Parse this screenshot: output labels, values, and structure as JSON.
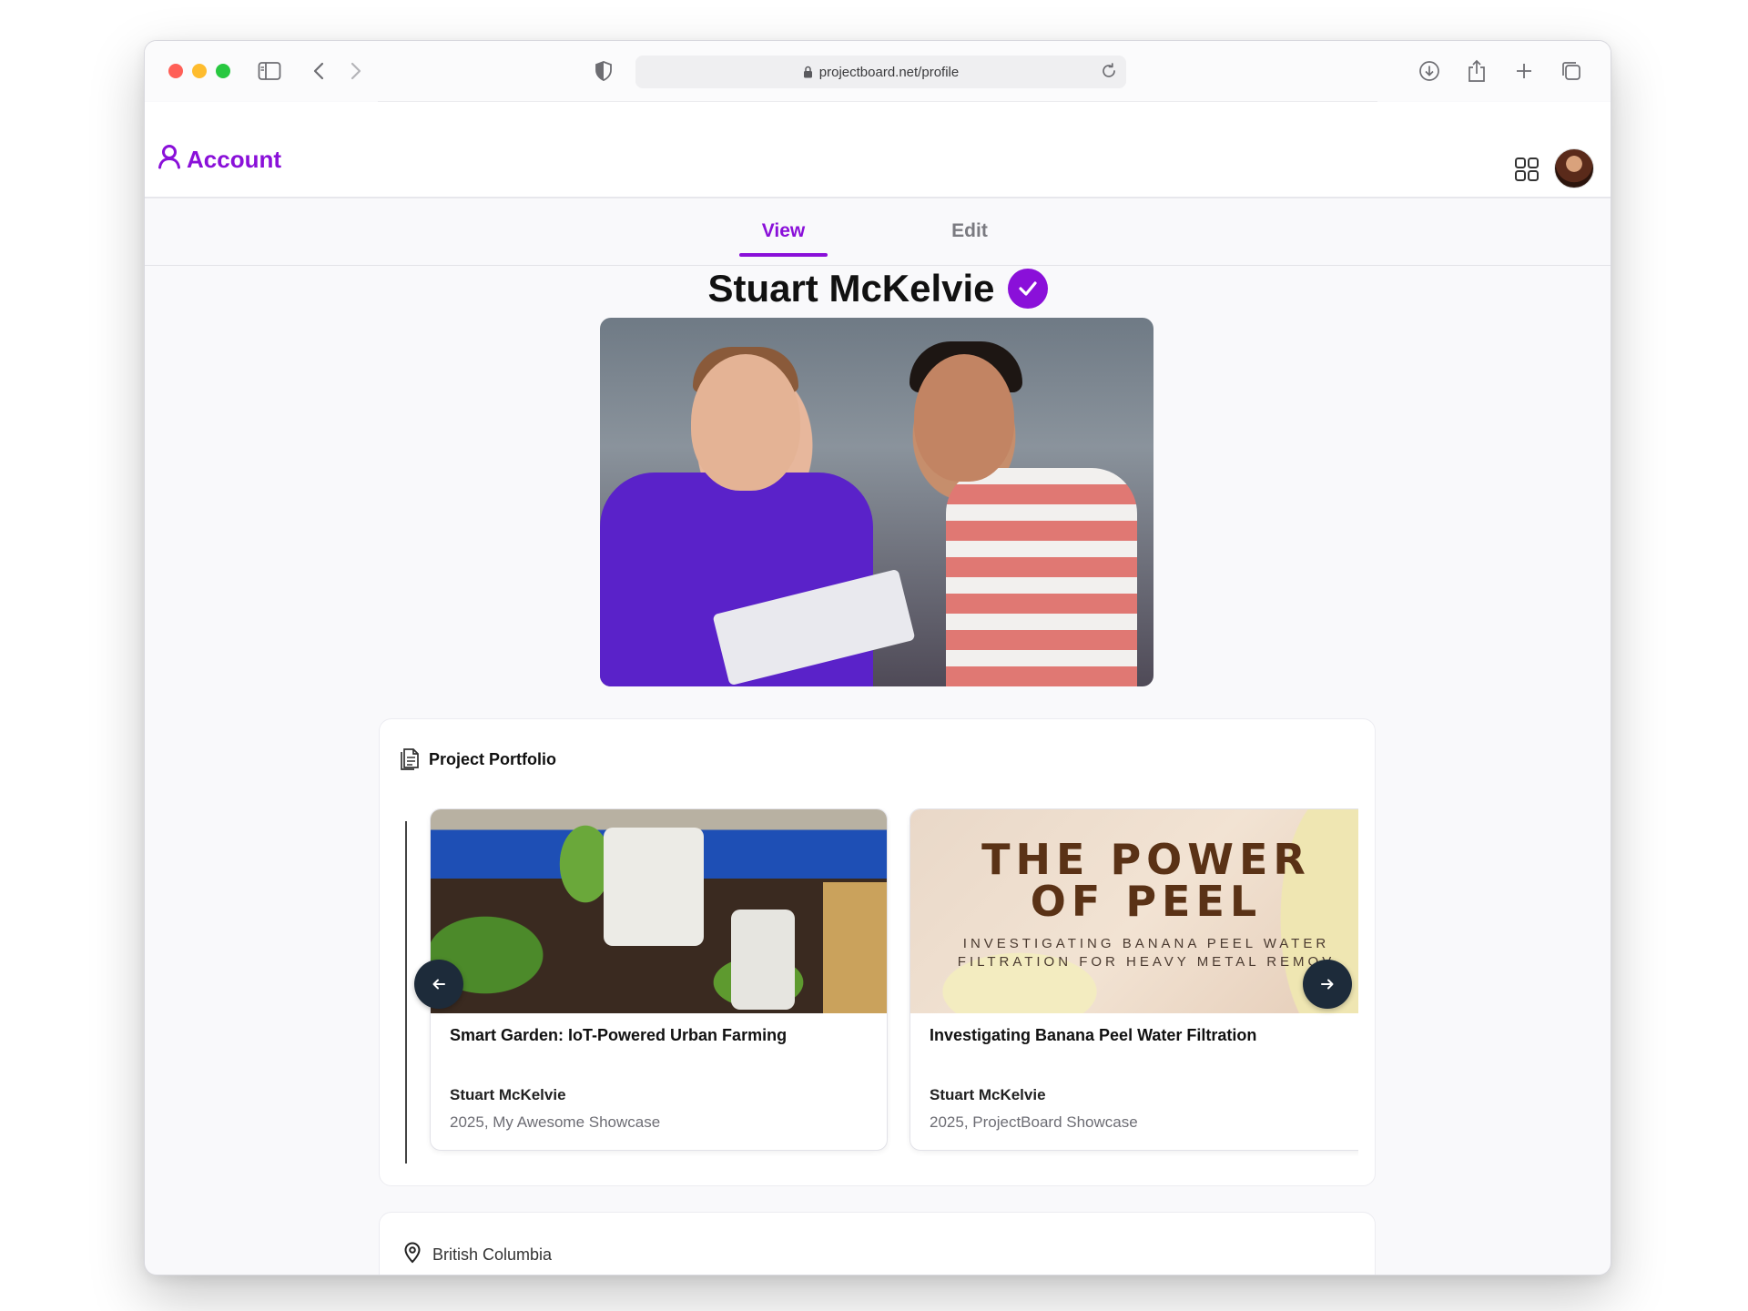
{
  "browser": {
    "url": "projectboard.net/profile"
  },
  "app": {
    "brand_label": "Account"
  },
  "tabs": [
    {
      "label": "View",
      "active": true
    },
    {
      "label": "Edit",
      "active": false
    }
  ],
  "profile": {
    "name": "Stuart McKelvie",
    "verified": true
  },
  "portfolio": {
    "title": "Project Portfolio",
    "projects": [
      {
        "title": "Smart Garden: IoT-Powered Urban Farming",
        "author": "Stuart McKelvie",
        "meta": "2025, My Awesome Showcase"
      },
      {
        "title": "Investigating Banana Peel Water Filtration",
        "author": "Stuart McKelvie",
        "meta": "2025, ProjectBoard Showcase",
        "cover_title_line1": "THE POWER",
        "cover_title_line2": "OF PEEL",
        "cover_sub_line1": "INVESTIGATING BANANA PEEL WATER",
        "cover_sub_line2": "FILTRATION FOR HEAVY METAL REMOV"
      }
    ]
  },
  "location": {
    "label": "British Columbia"
  },
  "colors": {
    "accent": "#8a10d9",
    "nav_button": "#1d2b3a"
  },
  "icons": [
    "sidebar-icon",
    "back-icon",
    "forward-icon",
    "shield-icon",
    "lock-icon",
    "reload-icon",
    "download-icon",
    "share-icon",
    "new-tab-icon",
    "tabs-overview-icon",
    "user-icon",
    "grid-icon",
    "check-icon",
    "documents-icon",
    "arrow-left-icon",
    "arrow-right-icon",
    "location-pin-icon"
  ]
}
